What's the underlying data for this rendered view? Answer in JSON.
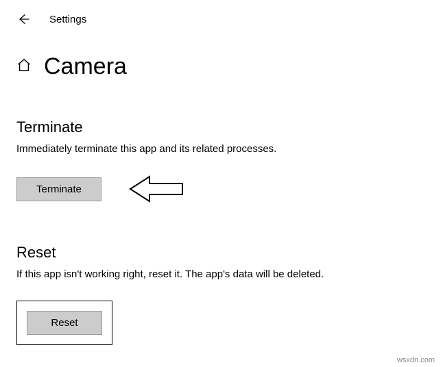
{
  "header": {
    "app_label": "Settings"
  },
  "page": {
    "title": "Camera"
  },
  "terminate": {
    "heading": "Terminate",
    "description": "Immediately terminate this app and its related processes.",
    "button_label": "Terminate"
  },
  "reset": {
    "heading": "Reset",
    "description": "If this app isn't working right, reset it. The app's data will be deleted.",
    "button_label": "Reset"
  },
  "watermark": "wsxdn.com"
}
